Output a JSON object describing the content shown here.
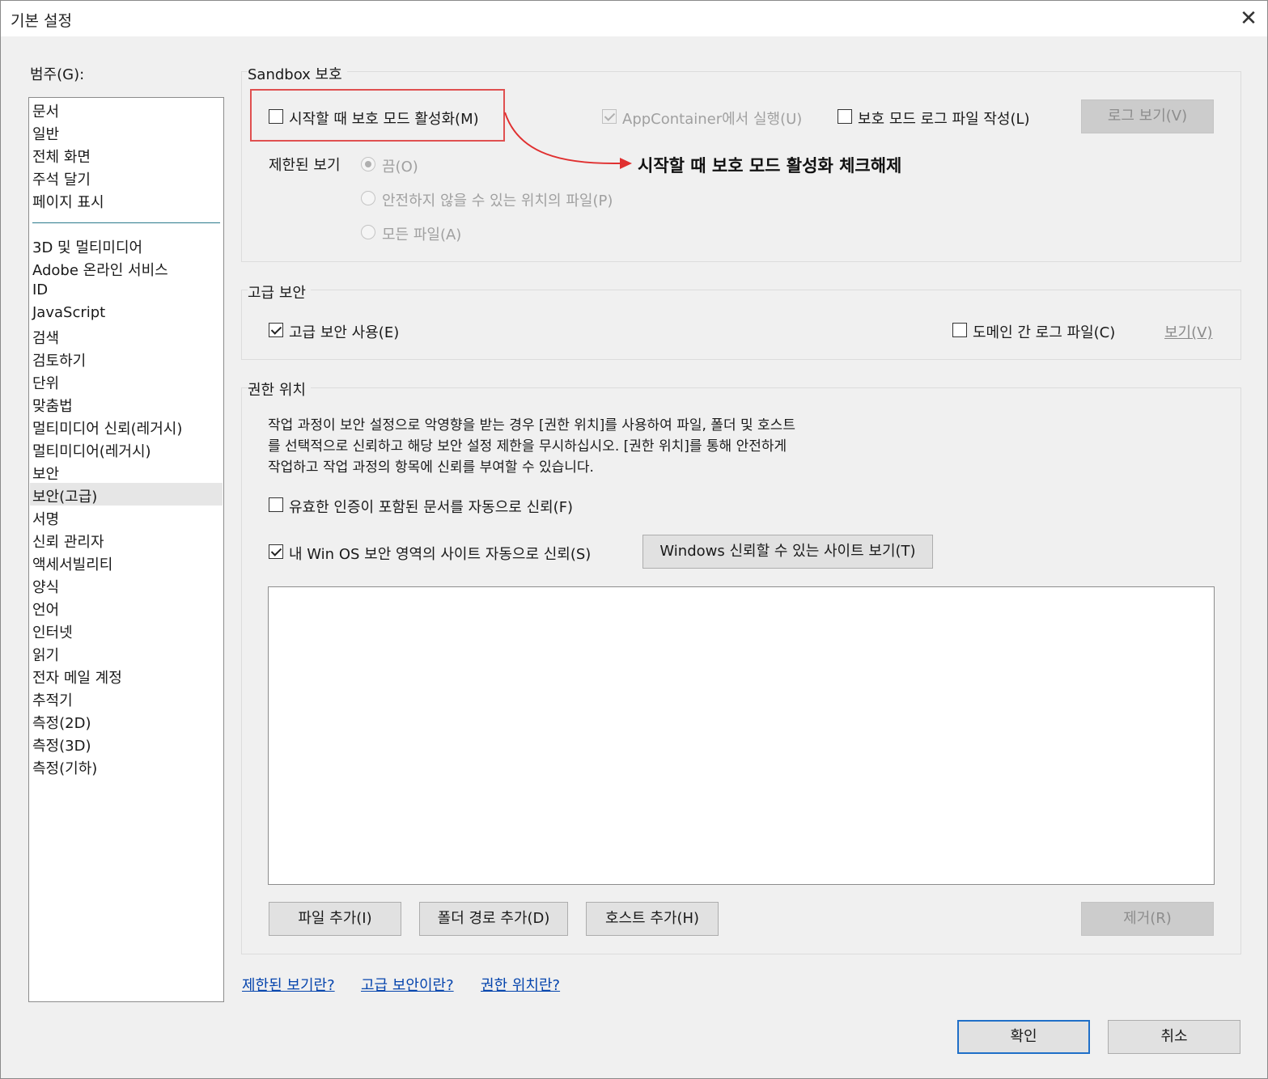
{
  "window": {
    "title": "기본 설정",
    "close_icon": "close-icon"
  },
  "categories": {
    "label": "범주(G):",
    "group1": [
      "문서",
      "일반",
      "전체 화면",
      "주석 달기",
      "페이지 표시"
    ],
    "group2": [
      "3D 및 멀티미디어",
      "Adobe 온라인 서비스",
      "ID",
      "JavaScript",
      "검색",
      "검토하기",
      "단위",
      "맞춤법",
      "멀티미디어 신뢰(레거시)",
      "멀티미디어(레거시)",
      "보안",
      "보안(고급)",
      "서명",
      "신뢰 관리자",
      "액세서빌리티",
      "양식",
      "언어",
      "인터넷",
      "읽기",
      "전자 메일 계정",
      "추적기",
      "측정(2D)",
      "측정(3D)",
      "측정(기하)"
    ],
    "selected": "보안(고급)"
  },
  "sandbox": {
    "title": "Sandbox 보호",
    "protected_mode": "시작할 때 보호 모드 활성화(M)",
    "appcontainer": "AppContainer에서 실행(U)",
    "log_file": "보호 모드 로그 파일 작성(L)",
    "view_log": "로그 보기(V)",
    "restricted_view": "제한된 보기",
    "radio_off": "끔(O)",
    "radio_unsafe": "안전하지 않을 수 있는 위치의 파일(P)",
    "radio_all": "모든 파일(A)"
  },
  "annotation": {
    "text": "시작할 때 보호 모드 활성화 체크해제",
    "color": "#e03030"
  },
  "advanced": {
    "title": "고급 보안",
    "enable": "고급 보안 사용(E)",
    "cross_domain": "도메인 간 로그 파일(C)",
    "view": "보기(V)"
  },
  "privileged": {
    "title": "권한 위치",
    "desc1": "작업 과정이 보안 설정으로 악영향을 받는 경우 [권한 위치]를 사용하여 파일, 폴더 및 호스트",
    "desc2": "를 선택적으로 신뢰하고 해당 보안 설정 제한을 무시하십시오. [권한 위치]를 통해 안전하게",
    "desc3": "작업하고 작업 과정의 항목에 신뢰를 부여할 수 있습니다.",
    "trust_certified": "유효한 인증이 포함된 문서를 자동으로 신뢰(F)",
    "trust_winos": "내 Win OS 보안 영역의 사이트 자동으로 신뢰(S)",
    "view_windows": "Windows 신뢰할 수 있는 사이트 보기(T)",
    "add_file": "파일 추가(I)",
    "add_folder": "폴더 경로 추가(D)",
    "add_host": "호스트 추가(H)",
    "remove": "제거(R)"
  },
  "links": {
    "restricted": "제한된 보기란?",
    "advanced": "고급 보안이란?",
    "privileged": "권한 위치란?"
  },
  "footer": {
    "ok": "확인",
    "cancel": "취소"
  }
}
